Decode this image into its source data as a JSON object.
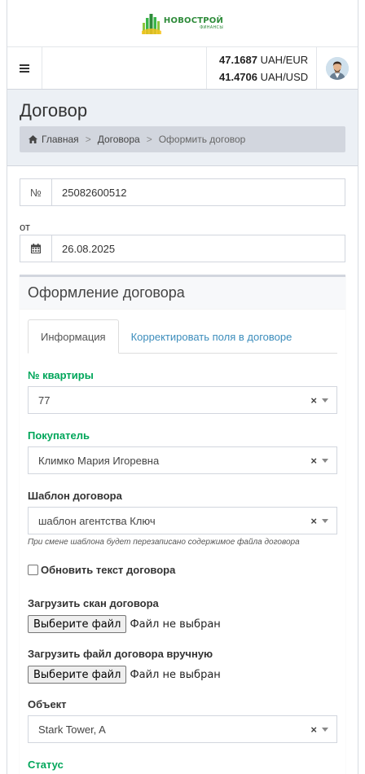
{
  "logo": {
    "name": "НОВОСТРОЙ",
    "sub": "ФИНАНСЫ",
    "icon": "buildings-logo-icon",
    "color": "#2e8b3a"
  },
  "topnav": {
    "menu_icon": "bars-icon",
    "rates": [
      {
        "value": "47.1687",
        "unit": "UAH/EUR"
      },
      {
        "value": "41.4706",
        "unit": "UAH/USD"
      }
    ],
    "avatar_icon": "user-avatar"
  },
  "page": {
    "title": "Договор",
    "breadcrumb": [
      "Главная",
      "Договора",
      "Оформить договор"
    ],
    "breadcrumb_sep": ">"
  },
  "contract": {
    "number_addon": "№",
    "number": "25082600512",
    "date_label": "от",
    "date_icon": "calendar-icon",
    "date": "26.08.2025"
  },
  "box": {
    "title": "Оформление договора",
    "tabs": [
      {
        "label": "Информация",
        "active": true
      },
      {
        "label": "Корректировать поля в договоре",
        "active": false
      }
    ]
  },
  "form": {
    "apartment_label": "№ квартиры",
    "apartment_value": "77",
    "buyer_label": "Покупатель",
    "buyer_value": "Климко Мария Игоревна",
    "template_label": "Шаблон договора",
    "template_value": "шаблон агентства Ключ",
    "template_hint": "При смене шаблона будет перезаписано содержимое файла договора",
    "update_text_label": "Обновить текст договора",
    "update_text_checked": false,
    "scan_label": "Загрузить скан договора",
    "manual_label": "Загрузить файл договора вручную",
    "file_button": "Выберите файл",
    "no_file": "Файл не выбран",
    "object_label": "Объект",
    "object_value": "Stark Tower, A",
    "status_label": "Статус",
    "clear_symbol": "×"
  },
  "colors": {
    "green": "#00a65a",
    "link": "#3c8dbc",
    "bg": "#ecf0f5"
  }
}
